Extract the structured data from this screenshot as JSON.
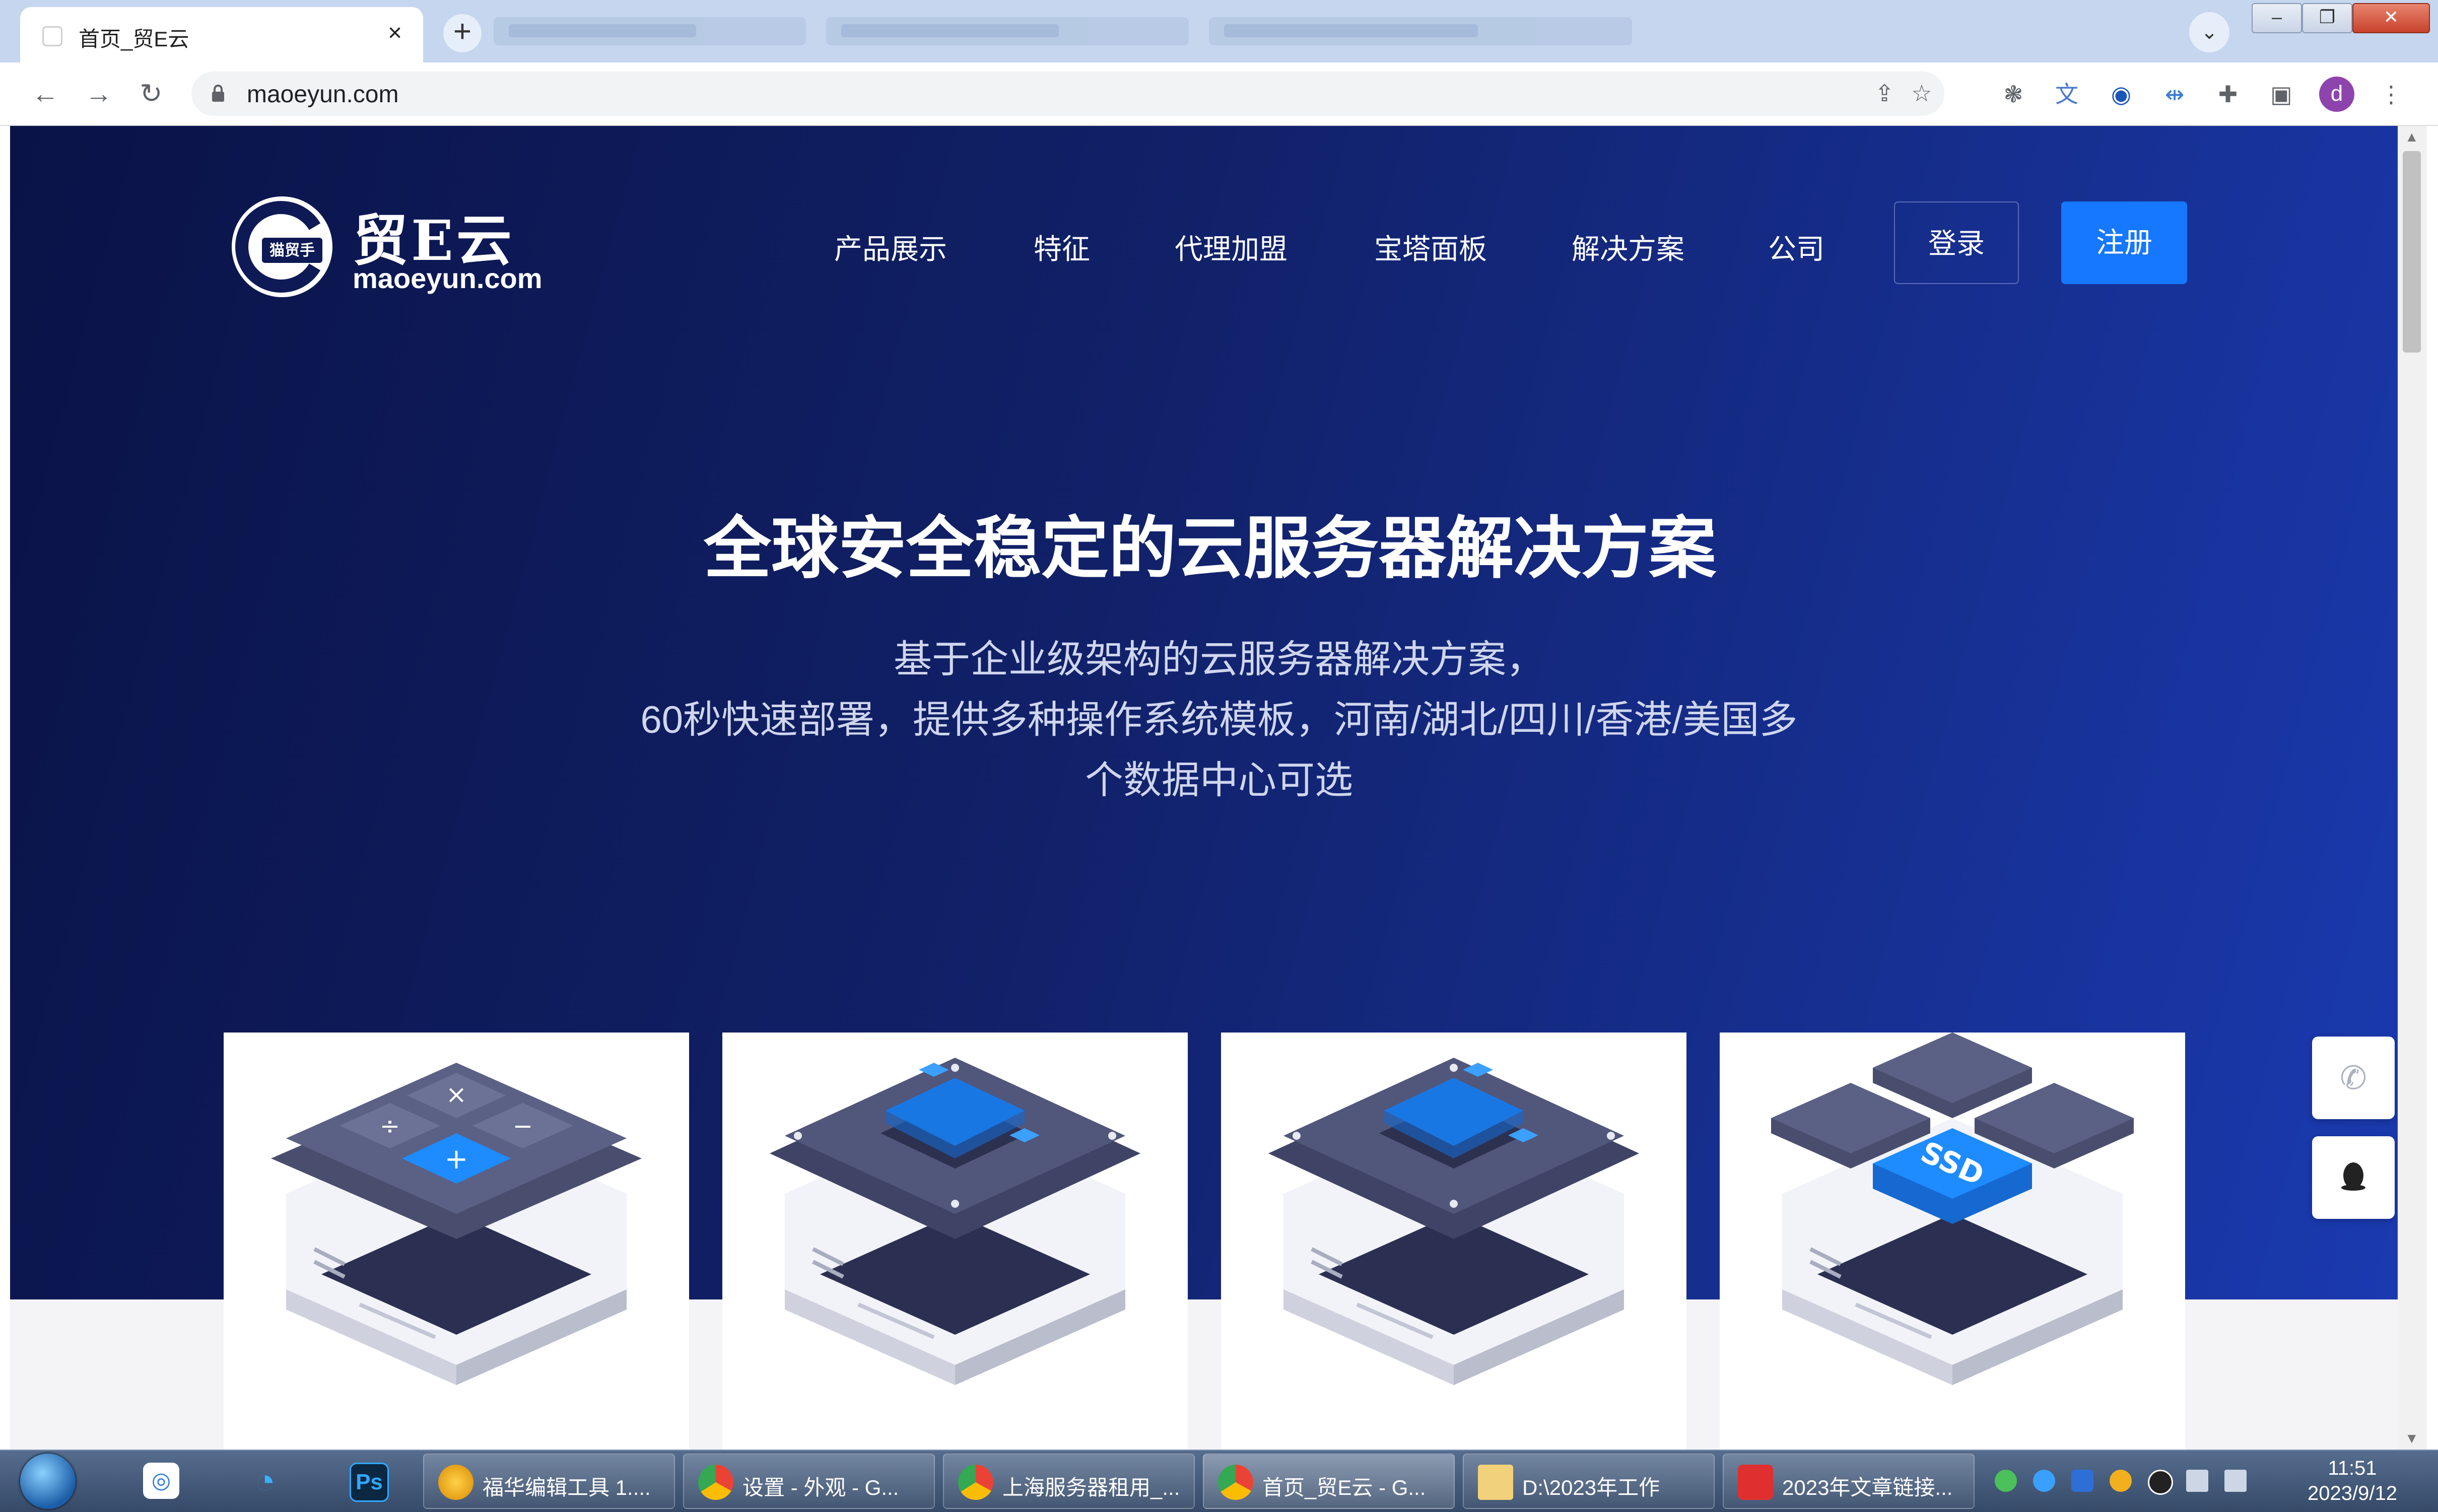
{
  "browser": {
    "active_tab_title": "首页_贸E云",
    "tab_close": "×",
    "new_tab": "+",
    "url": "maoeyun.com",
    "profile_initial": "d"
  },
  "site": {
    "logo_text": "贸E云",
    "logo_domain": "maoeyun.com",
    "logo_mark": "猫贸手",
    "nav": [
      "产品展示",
      "特征",
      "代理加盟",
      "宝塔面板",
      "解决方案",
      "公司"
    ],
    "login_label": "登录",
    "register_label": "注册"
  },
  "hero": {
    "title": "全球安全稳定的云服务器解决方案",
    "subtitle_lines": [
      "基于企业级架构的云服务器解决方案，",
      "60秒快速部署，提供多种操作系统模板，河南/湖北/四川/香港/美国多",
      "个数据中心可选"
    ]
  },
  "cards": [
    {
      "icon": "calculator-server-icon"
    },
    {
      "icon": "cpu-chip-server-icon"
    },
    {
      "icon": "cpu-chip-server-icon"
    },
    {
      "icon": "ssd-server-icon",
      "chip_label": "SSD"
    }
  ],
  "side_float": [
    {
      "icon": "phone-icon"
    },
    {
      "icon": "qq-penguin-icon"
    }
  ],
  "taskbar": {
    "tasks": [
      {
        "label": "福华编辑工具 1...."
      },
      {
        "label": "设置 - 外观 - G..."
      },
      {
        "label": "上海服务器租用_..."
      },
      {
        "label": "首页_贸E云 - G..."
      },
      {
        "label": "D:\\2023年工作"
      },
      {
        "label": "2023年文章链接..."
      }
    ],
    "time": "11:51",
    "date": "2023/9/12"
  },
  "colors": {
    "hero_start": "#0a1347",
    "hero_end": "#1a3ab0",
    "register_button": "#1677ff",
    "chip_blue": "#1e8cff"
  }
}
